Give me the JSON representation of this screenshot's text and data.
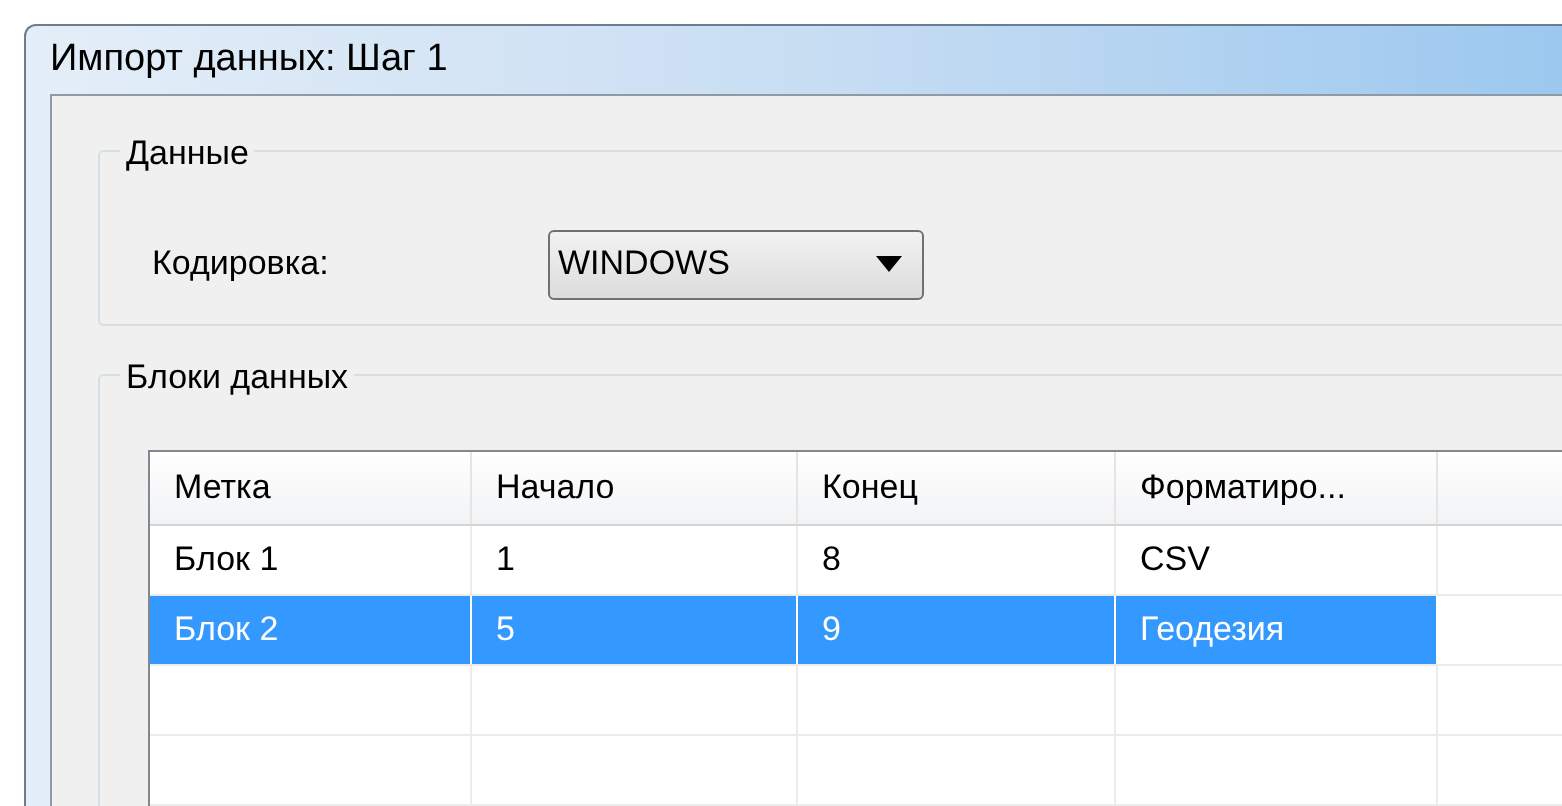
{
  "window": {
    "title": "Импорт данных: Шаг 1"
  },
  "data_group": {
    "title": "Данные",
    "encoding_label": "Кодировка:",
    "encoding_value": "WINDOWS"
  },
  "blocks_group": {
    "title": "Блоки данных"
  },
  "table": {
    "columns": [
      "Метка",
      "Начало",
      "Конец",
      "Форматиро..."
    ],
    "rows": [
      {
        "cells": [
          "Блок 1",
          "1",
          "8",
          "CSV"
        ],
        "selected": false
      },
      {
        "cells": [
          "Блок 2",
          "5",
          "9",
          "Геодезия"
        ],
        "selected": true
      }
    ]
  }
}
